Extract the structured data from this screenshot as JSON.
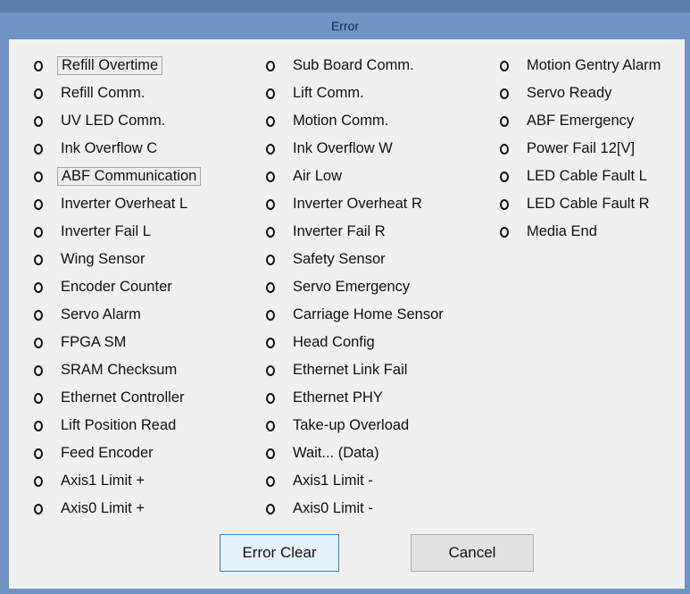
{
  "window": {
    "title": "Error"
  },
  "columns": [
    [
      "Refill Overtime",
      "Refill Comm.",
      "UV LED Comm.",
      "Ink Overflow C",
      "ABF Communication",
      "Inverter Overheat L",
      "Inverter Fail L",
      "Wing Sensor",
      "Encoder Counter",
      "Servo Alarm",
      "FPGA SM",
      "SRAM Checksum",
      "Ethernet Controller",
      "Lift Position Read",
      "Feed Encoder",
      "Axis1 Limit +",
      "Axis0 Limit +"
    ],
    [
      "Sub Board Comm.",
      "Lift Comm.",
      "Motion Comm.",
      "Ink Overflow W",
      "Air Low",
      "Inverter Overheat R",
      "Inverter Fail R",
      "Safety Sensor",
      "Servo Emergency",
      "Carriage Home Sensor",
      "Head Config",
      "Ethernet Link Fail",
      "Ethernet PHY",
      "Take-up Overload",
      "Wait... (Data)",
      "Axis1 Limit -",
      "Axis0 Limit -"
    ],
    [
      "Motion Gentry Alarm",
      "Servo Ready",
      "ABF Emergency",
      "Power Fail 12[V]",
      "LED Cable Fault L",
      "LED Cable Fault R",
      "Media End"
    ]
  ],
  "highlighted": [
    "Refill Overtime",
    "ABF Communication"
  ],
  "buttons": {
    "error_clear": "Error Clear",
    "cancel": "Cancel"
  },
  "icons": {
    "indicator": "status-indicator-icon"
  }
}
